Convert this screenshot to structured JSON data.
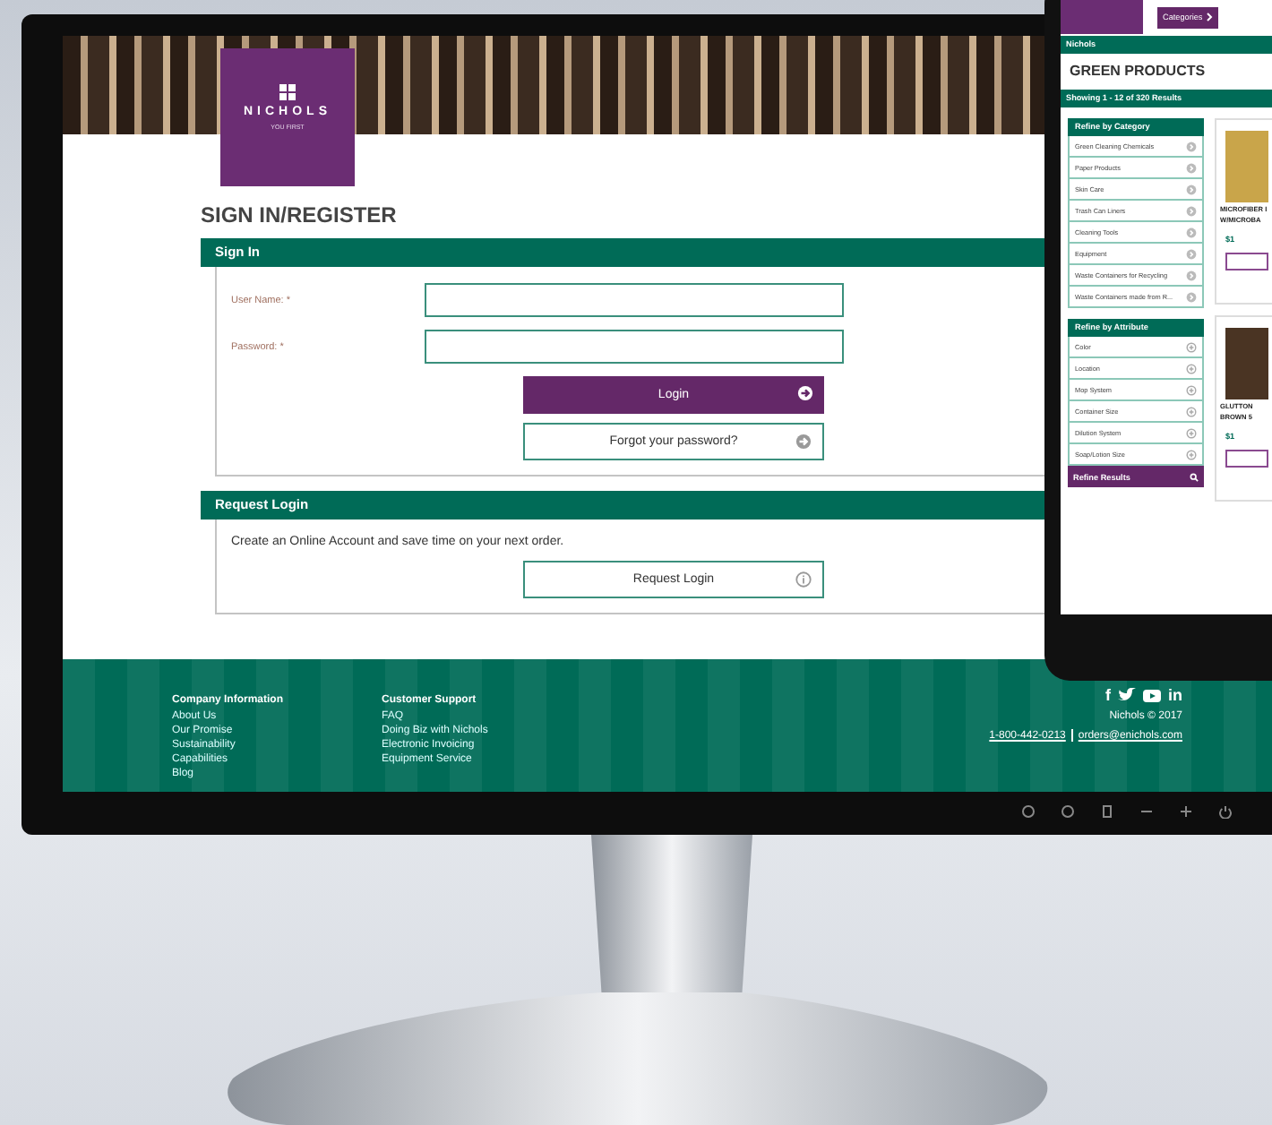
{
  "monitor": {
    "site": {
      "logo": {
        "name": "NICHOLS",
        "tagline": "YOU FIRST"
      },
      "page_title": "SIGN IN/REGISTER",
      "sign_in": {
        "heading": "Sign In",
        "fields": [
          {
            "label": "User Name: *"
          },
          {
            "label": "Password: *"
          }
        ],
        "login_button": "Login",
        "forgot_button": "Forgot your password?"
      },
      "request_login": {
        "heading": "Request Login",
        "text": "Create an Online Account and save time on your next order.",
        "button": "Request Login"
      },
      "footer": {
        "columns": [
          {
            "heading": "Company Information",
            "links": [
              "About Us",
              "Our Promise",
              "Sustainability",
              "Capabilities",
              "Blog"
            ]
          },
          {
            "heading": "Customer Support",
            "links": [
              "FAQ",
              "Doing Biz with Nichols",
              "Electronic Invoicing",
              "Equipment Service"
            ]
          }
        ],
        "social": [
          "f",
          "in"
        ],
        "copyright": "Nichols © 2017",
        "phone": "1-800-442-0213",
        "email": "orders@enichols.com"
      }
    }
  },
  "tablet": {
    "site": {
      "categories_button": "Categories",
      "breadcrumb": "Nichols",
      "title": "GREEN PRODUCTS",
      "results": "Showing 1 - 12 of 320 Results",
      "refine_category": {
        "heading": "Refine by Category",
        "items": [
          "Green Cleaning Chemicals",
          "Paper Products",
          "Skin Care",
          "Trash Can Liners",
          "Cleaning Tools",
          "Equipment",
          "Waste Containers for Recycling",
          "Waste Containers made from R..."
        ]
      },
      "refine_attribute": {
        "heading": "Refine by Attribute",
        "items": [
          "Color",
          "Location",
          "Mop System",
          "Container Size",
          "Dilution System",
          "Soap/Lotion Size"
        ]
      },
      "refine_button": "Refine Results",
      "products": [
        {
          "name": "MICROFIBER I",
          "name_2": "W/MICROBA",
          "price": "$1"
        },
        {
          "name": "GLUTTON",
          "name_2": "BROWN 5",
          "price": "$1"
        }
      ]
    }
  }
}
